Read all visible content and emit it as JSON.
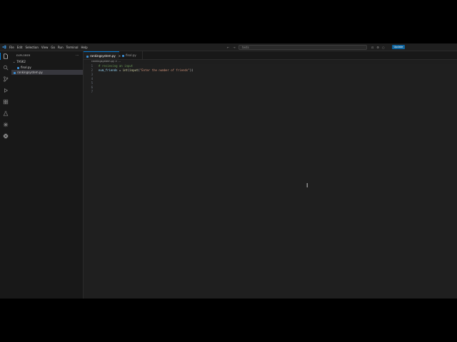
{
  "menu": [
    "File",
    "Edit",
    "Selection",
    "View",
    "Go",
    "Run",
    "Terminal",
    "Help"
  ],
  "search": {
    "text": "tests"
  },
  "update_label": "Update",
  "explorer": {
    "header": "EXPLORER",
    "more": "···",
    "folder": "TASK2",
    "files": [
      "final.py",
      "rankingsystem.py"
    ]
  },
  "tabs": [
    {
      "label": "rankingsystem.py",
      "active": true,
      "close": "×"
    },
    {
      "label": "final.py",
      "active": false
    }
  ],
  "breadcrumb": "rankingsystem.py > ...",
  "code": {
    "line_numbers": [
      "1",
      "2",
      "3",
      "4",
      "5",
      "6",
      "7"
    ],
    "line1_comment": "# recieving an input",
    "line2": {
      "var": "num_friends",
      "op": " = ",
      "fn1": "int",
      "p1": "(",
      "fn2": "input",
      "p2": "(",
      "str": "\"Enter the number of friends\"",
      "p3": "))"
    }
  },
  "colors": {
    "accent": "#0078d4",
    "update_button": "#0e639c",
    "comment": "#6a9955",
    "string": "#ce9178",
    "function": "#dcdcaa",
    "variable": "#9cdcfe"
  }
}
